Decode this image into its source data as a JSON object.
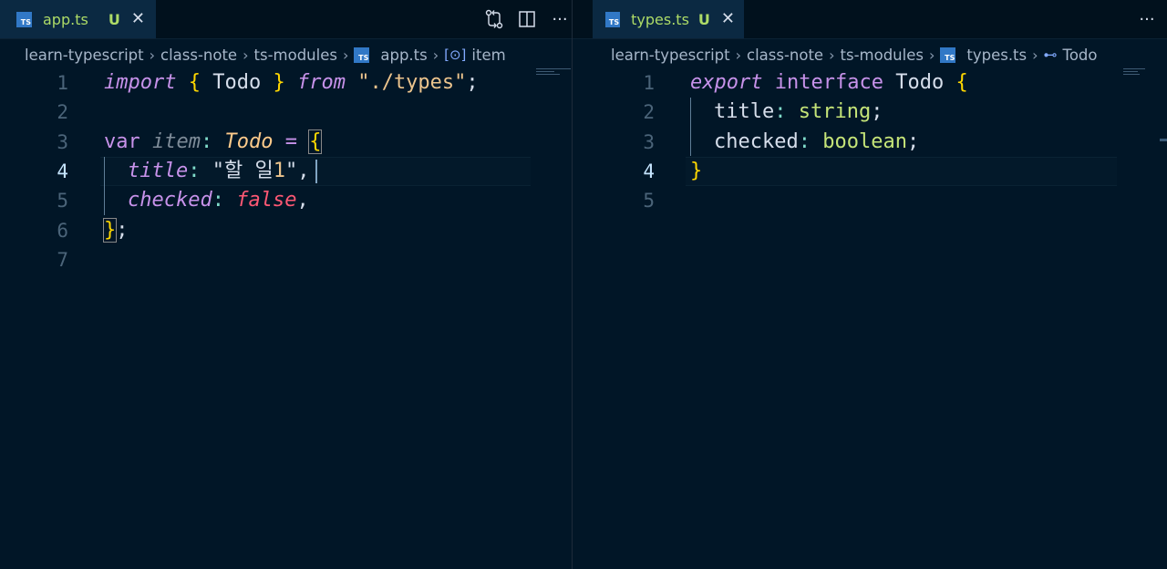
{
  "left": {
    "tab": {
      "label": "app.ts",
      "status": "U",
      "icon": "typescript-file-icon"
    },
    "breadcrumb": [
      "learn-typescript",
      "class-note",
      "ts-modules",
      "app.ts",
      "item"
    ],
    "lines": [
      "1",
      "2",
      "3",
      "4",
      "5",
      "6",
      "7"
    ],
    "code": {
      "l1_import": "import",
      "l1_ob": "{",
      "l1_todo": " Todo ",
      "l1_cb": "}",
      "l1_from": "from",
      "l1_path": "\"./types\"",
      "l1_semi": ";",
      "l3_var": "var",
      "l3_item": "item",
      "l3_colon": ":",
      "l3_todo": "Todo",
      "l3_eq": "=",
      "l3_ob": "{",
      "l4_title": "title",
      "l4_colon": ":",
      "l4_q1": "\"",
      "l4_text": "할 일",
      "l4_num": "1",
      "l4_q2": "\"",
      "l4_comma": ",",
      "l5_checked": "checked",
      "l5_colon": ":",
      "l5_false": "false",
      "l5_comma": ",",
      "l6_cb": "}",
      "l6_semi": ";"
    }
  },
  "right": {
    "tab": {
      "label": "types.ts",
      "status": "U",
      "icon": "typescript-file-icon"
    },
    "breadcrumb": [
      "learn-typescript",
      "class-note",
      "ts-modules",
      "types.ts",
      "Todo"
    ],
    "lines": [
      "1",
      "2",
      "3",
      "4",
      "5"
    ],
    "code": {
      "l1_export": "export",
      "l1_interface": "interface",
      "l1_todo": "Todo",
      "l1_ob": "{",
      "l2_title": "title",
      "l2_colon": ":",
      "l2_type": "string",
      "l2_semi": ";",
      "l3_checked": "checked",
      "l3_colon": ":",
      "l3_type": "boolean",
      "l3_semi": ";",
      "l4_cb": "}"
    }
  },
  "toolbar": {
    "compare_icon": "git-compare-icon",
    "split_icon": "split-editor-icon",
    "more_label": "···"
  },
  "colors": {
    "background": "#011627",
    "keyword": "#c792ea",
    "brace": "#ffd700",
    "string": "#ecc48d",
    "boolean": "#ff5874",
    "type": "#c5e478",
    "tab_label": "#addb67"
  }
}
